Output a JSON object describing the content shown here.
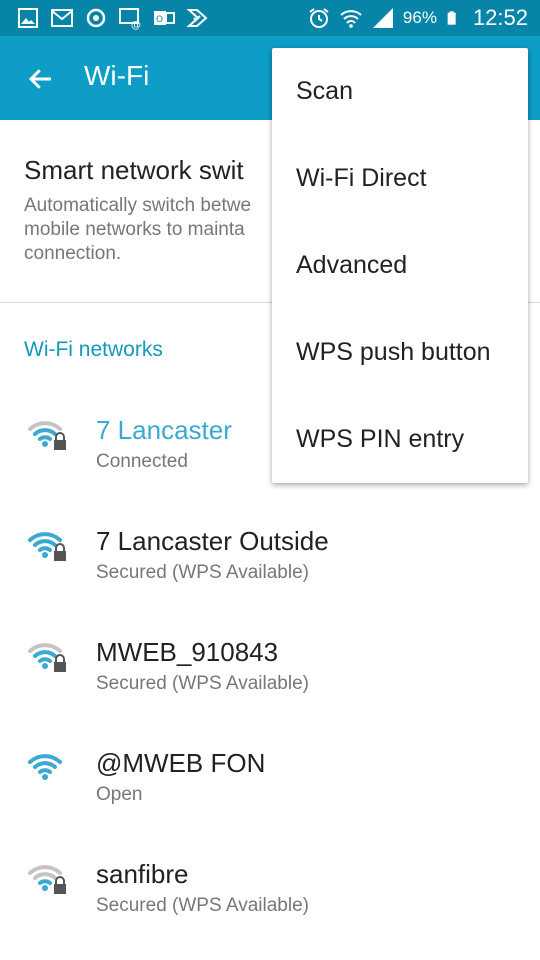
{
  "status_bar": {
    "left_icons": [
      "gallery-icon",
      "gmail-icon",
      "sync-icon",
      "photo-message-icon",
      "outlook-icon",
      "tasks-icon"
    ],
    "right_icons": [
      "alarm-icon",
      "wifi-status-icon",
      "signal-icon"
    ],
    "battery": "96%",
    "time": "12:52"
  },
  "app_bar": {
    "title": "Wi-Fi"
  },
  "smart_switch": {
    "title": "Smart network swit",
    "description": "Automatically switch betwe mobile networks to mainta connection."
  },
  "section_header": "Wi-Fi networks",
  "networks": [
    {
      "ssid": "7 Lancaster",
      "status": "Connected",
      "locked": true,
      "signal": "partial"
    },
    {
      "ssid": "7 Lancaster Outside",
      "status": "Secured (WPS Available)",
      "locked": true,
      "signal": "full"
    },
    {
      "ssid": "MWEB_910843",
      "status": "Secured (WPS Available)",
      "locked": true,
      "signal": "partial"
    },
    {
      "ssid": "@MWEB FON",
      "status": "Open",
      "locked": false,
      "signal": "full"
    },
    {
      "ssid": "sanfibre",
      "status": "Secured (WPS Available)",
      "locked": true,
      "signal": "weak"
    }
  ],
  "menu": {
    "items": [
      "Scan",
      "Wi-Fi Direct",
      "Advanced",
      "WPS push button",
      "WPS PIN entry"
    ]
  },
  "colors": {
    "status_bar": "#0785a8",
    "app_bar": "#0e9dc6",
    "accent": "#1497bd",
    "connected_text": "#3aa9d3",
    "wifi_active": "#3aa9d3",
    "wifi_inactive": "#c4c4c4"
  }
}
